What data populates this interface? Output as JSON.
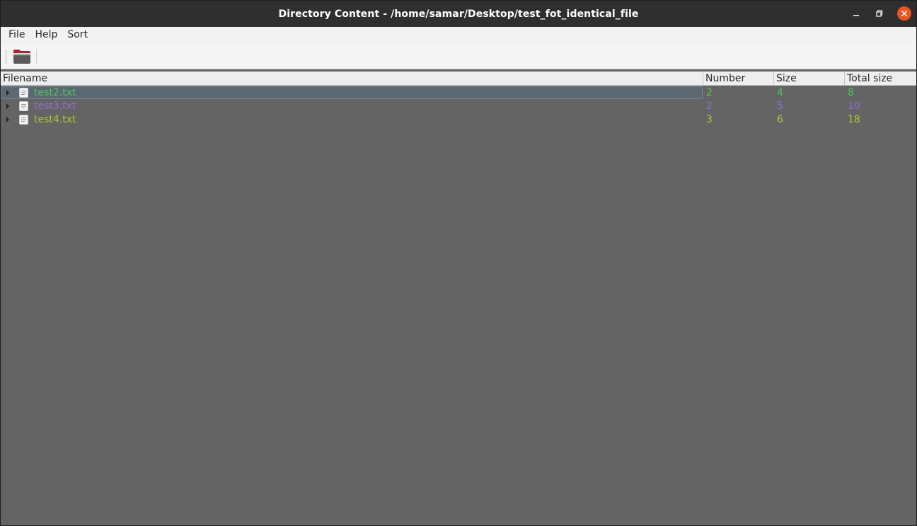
{
  "window": {
    "title": "Directory Content - /home/samar/Desktop/test_fot_identical_file"
  },
  "menu": {
    "items": [
      "File",
      "Help",
      "Sort"
    ]
  },
  "toolbar": {
    "open_icon": "folder-open-icon"
  },
  "table": {
    "columns": [
      "Filename",
      "Number",
      "Size",
      "Total size"
    ],
    "rows": [
      {
        "filename": "test2.txt",
        "number": "2",
        "size": "4",
        "total": "8",
        "color": "#4fc35a",
        "selected": true
      },
      {
        "filename": "test3.txt",
        "number": "2",
        "size": "5",
        "total": "10",
        "color": "#8e6ed4",
        "selected": false
      },
      {
        "filename": "test4.txt",
        "number": "3",
        "size": "6",
        "total": "18",
        "color": "#b7c23a",
        "selected": false
      }
    ]
  },
  "colors": {
    "titlebar": "#2f2f2f",
    "close_button": "#e9541f",
    "view_background": "#646464",
    "selection": "#5c6872"
  }
}
